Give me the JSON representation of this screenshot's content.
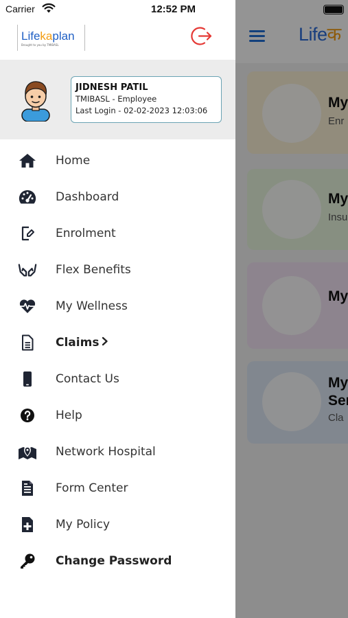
{
  "status_bar": {
    "carrier": "Carrier",
    "time": "12:52 PM"
  },
  "logo": {
    "text_a": "Life",
    "text_b": "ka",
    "text_c": "plan",
    "tagline": "Brought to you by TMIBASL"
  },
  "profile": {
    "name": "JIDNESH PATIL",
    "role": "TMIBASL - Employee",
    "last_login": "Last Login - 02-02-2023 12:03:06"
  },
  "menu": [
    {
      "label": "Home",
      "icon": "home-icon"
    },
    {
      "label": "Dashboard",
      "icon": "speedometer-icon"
    },
    {
      "label": "Enrolment",
      "icon": "edit-document-icon"
    },
    {
      "label": "Flex Benefits",
      "icon": "hands-icon"
    },
    {
      "label": "My Wellness",
      "icon": "heartbeat-icon"
    },
    {
      "label": "Claims",
      "icon": "document-icon",
      "expandable": true
    },
    {
      "label": "Contact Us",
      "icon": "phone-icon"
    },
    {
      "label": "Help",
      "icon": "help-icon"
    },
    {
      "label": "Network Hospital",
      "icon": "map-pin-icon"
    },
    {
      "label": "Form Center",
      "icon": "form-icon"
    },
    {
      "label": "My Policy",
      "icon": "policy-icon"
    },
    {
      "label": "Change Password",
      "icon": "key-icon"
    }
  ],
  "background": {
    "logo_text": "Life",
    "cards": [
      {
        "title": "My",
        "subtitle": "Enr",
        "color": "#fbf1d6"
      },
      {
        "title": "My",
        "subtitle": "Insu",
        "color": "#e9f6df"
      },
      {
        "title": "My",
        "subtitle": "",
        "color": "#f3e3f4"
      },
      {
        "title": "My",
        "title2": "Ser",
        "subtitle": "Cla",
        "color": "#dfe9f7"
      }
    ]
  },
  "colors": {
    "accent": "#1f6fd6",
    "logout": "#e53935",
    "card_border": "#6aa3b3"
  }
}
